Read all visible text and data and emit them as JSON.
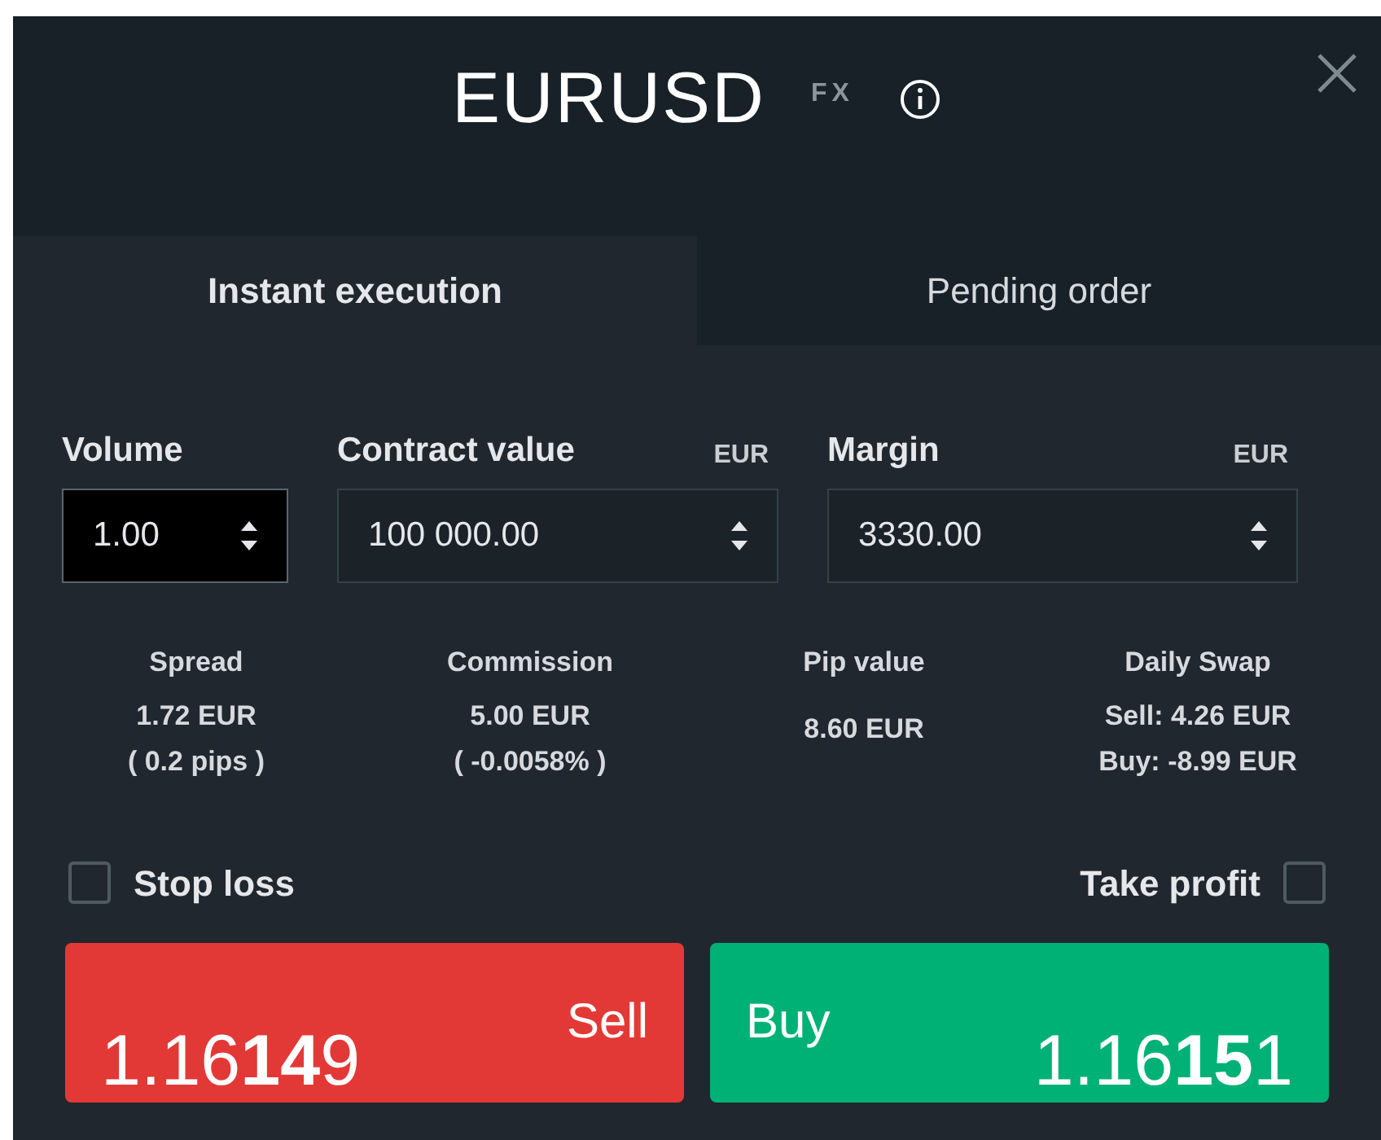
{
  "header": {
    "symbol": "EURUSD",
    "tag": "FX"
  },
  "tabs": [
    {
      "label": "Instant execution",
      "selected": true
    },
    {
      "label": "Pending order",
      "selected": false
    }
  ],
  "fields": [
    {
      "label": "Volume",
      "value": "1.00",
      "focused": true
    },
    {
      "label": "Contract value",
      "unit": "EUR",
      "value": "100 000.00",
      "focused": false
    },
    {
      "label": "Margin",
      "unit": "EUR",
      "value": "3330.00",
      "focused": false
    }
  ],
  "stats": [
    {
      "title": "Spread",
      "lines": [
        "1.72 EUR",
        "( 0.2 pips )"
      ]
    },
    {
      "title": "Commission",
      "lines": [
        "5.00 EUR",
        "( -0.0058% )"
      ]
    },
    {
      "title": "Pip value",
      "lines": [
        "8.60 EUR"
      ]
    },
    {
      "title": "Daily Swap",
      "lines": [
        "Sell: 4.26 EUR",
        "Buy: -8.99 EUR"
      ]
    }
  ],
  "stop_loss": {
    "label": "Stop loss",
    "checked": false
  },
  "take_profit": {
    "label": "Take profit",
    "checked": false
  },
  "sell": {
    "label": "Sell",
    "price": "1.16**14**9"
  },
  "buy": {
    "label": "Buy",
    "price": "1.16**15**1"
  }
}
